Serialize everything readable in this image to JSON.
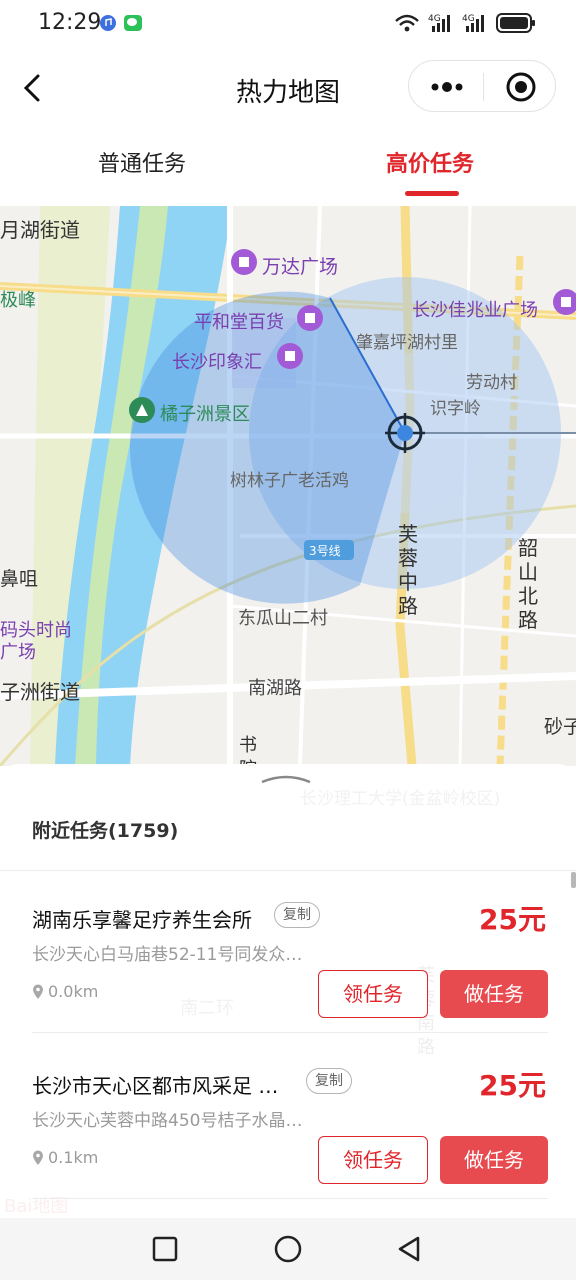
{
  "status_bar": {
    "time": "12:29",
    "network1": "4G",
    "network2": "4G"
  },
  "nav": {
    "title": "热力地图"
  },
  "tabs": [
    {
      "label": "普通任务",
      "active": false
    },
    {
      "label": "高价任务",
      "active": true
    }
  ],
  "map": {
    "labels": {
      "yuehu": "月湖街道",
      "wanda": "万达广场",
      "jifeng": "极峰",
      "pinghetang": "平和堂百货",
      "changsha_jiazhaoye": "长沙佳兆业广场",
      "zhaojiaping": "肇嘉坪湖村里",
      "changsha_yinxianghui": "长沙印象汇",
      "laodongcun": "劳动村",
      "shiziling": "识字岭",
      "juzizhou": "橘子洲景区",
      "shulinzi": "树林子广老活鸡",
      "line3": "3号线",
      "furong_road": "芙蓉中路",
      "shaoshan_road": "韶山北路",
      "bizui": "鼻咀",
      "matou": "码头时尚",
      "guangchang": "广场",
      "dongguashan": "东瓜山二村",
      "zizhou": "子洲街道",
      "nanhu_road": "南湖路",
      "shazi": "砂子",
      "shuyuan_road": "书院南路",
      "ligong": "长沙理工大学(金盆岭校区)",
      "nanerhuan": "南二环",
      "furong_nan": "芙蓉南路",
      "baidu_logo": "Bai地图"
    }
  },
  "sheet": {
    "title": "附近任务(1759)",
    "copy_label": "复制",
    "claim_label": "领任务",
    "do_label": "做任务",
    "tasks": [
      {
        "name": "湖南乐享馨足疗养生会所",
        "price": "25元",
        "address": "长沙天心白马庙巷52-11号同发众…",
        "distance": "0.0km"
      },
      {
        "name": "长沙市天心区都市风采足 …",
        "price": "25元",
        "address": "长沙天心芙蓉中路450号桔子水晶…",
        "distance": "0.1km"
      }
    ]
  },
  "colors": {
    "accent": "#e0262b",
    "do_button": "#e84b4f",
    "heat": "#3d86e0"
  }
}
